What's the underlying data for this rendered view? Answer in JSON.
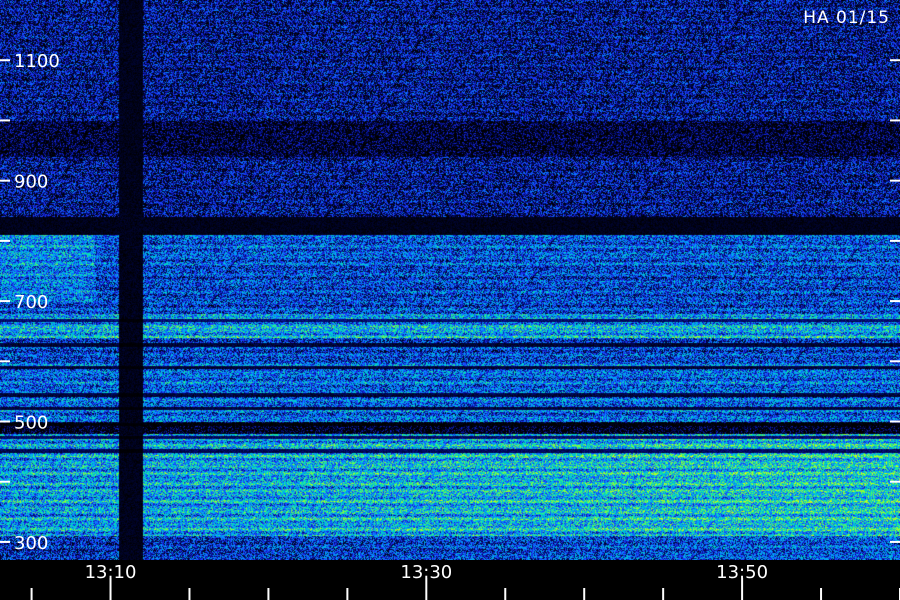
{
  "chart_data": {
    "type": "heatmap",
    "station_label": "HA 01/15",
    "title": "",
    "xlabel": "",
    "ylabel": "",
    "x_axis": {
      "start": "13:03",
      "end": "14:00",
      "tick_step_minutes": 5,
      "tick_labels": [
        "13:10",
        "13:30",
        "13:50"
      ]
    },
    "y_axis": {
      "range": [
        270,
        1200
      ],
      "tick_values": [
        300,
        400,
        500,
        600,
        700,
        800,
        900,
        1000,
        1100
      ],
      "tick_labels": [
        {
          "value": 300,
          "label": "300"
        },
        {
          "value": 500,
          "label": "500"
        },
        {
          "value": 700,
          "label": "700"
        },
        {
          "value": 900,
          "label": "900"
        },
        {
          "value": 1100,
          "label": "1100"
        }
      ]
    },
    "colormap": [
      "#000000",
      "#000a6e",
      "#1e32ff",
      "#00a0ff",
      "#00e6b4",
      "#8cff32",
      "#ffff00"
    ],
    "background_color": "#000000",
    "gaps": {
      "time": [
        {
          "start": "13:10:30",
          "end": "13:12:00"
        }
      ],
      "frequency": [
        {
          "start": 810,
          "end": 840
        }
      ]
    },
    "bands": [
      {
        "from": 820,
        "to": 1200,
        "intensity": 0.22
      },
      {
        "from": 940,
        "to": 1000,
        "intensity": 0.05
      },
      {
        "from": 760,
        "to": 820,
        "intensity": 0.42
      },
      {
        "from": 600,
        "to": 760,
        "intensity": 0.38
      },
      {
        "from": 640,
        "to": 680,
        "intensity": 0.62
      },
      {
        "from": 500,
        "to": 600,
        "intensity": 0.46
      },
      {
        "from": 310,
        "to": 480,
        "intensity": 0.58
      },
      {
        "from": 270,
        "to": 310,
        "intensity": 0.3
      }
    ],
    "dark_lines": [
      668,
      628,
      590,
      545,
      522,
      496,
      474,
      452
    ]
  }
}
